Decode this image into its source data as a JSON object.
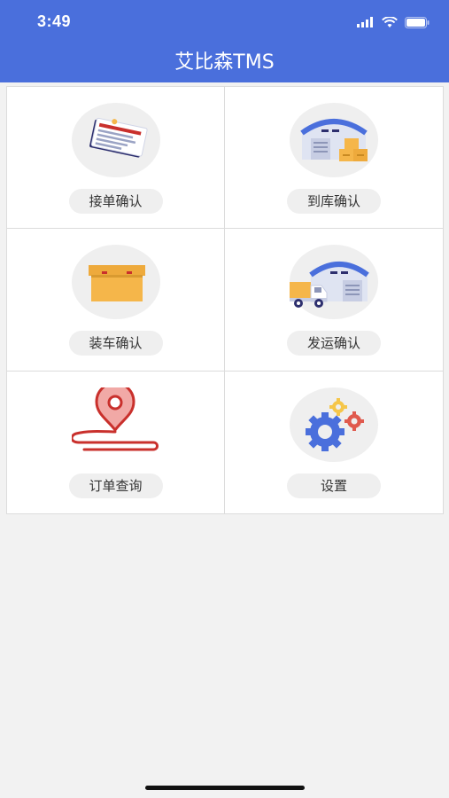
{
  "status_bar": {
    "time": "3:49"
  },
  "nav": {
    "title": "艾比森TMS"
  },
  "menu": [
    {
      "label": "接单确认",
      "icon": "clipboard-order-icon"
    },
    {
      "label": "到库确认",
      "icon": "warehouse-boxes-icon"
    },
    {
      "label": "装车确认",
      "icon": "cargo-box-icon"
    },
    {
      "label": "发运确认",
      "icon": "delivery-truck-warehouse-icon"
    },
    {
      "label": "订单查询",
      "icon": "location-pin-route-icon"
    },
    {
      "label": "设置",
      "icon": "gears-icon"
    }
  ],
  "colors": {
    "header": "#4a6fdc",
    "background": "#f2f2f2",
    "accent_orange": "#f5b64a",
    "accent_red": "#c9302c"
  }
}
